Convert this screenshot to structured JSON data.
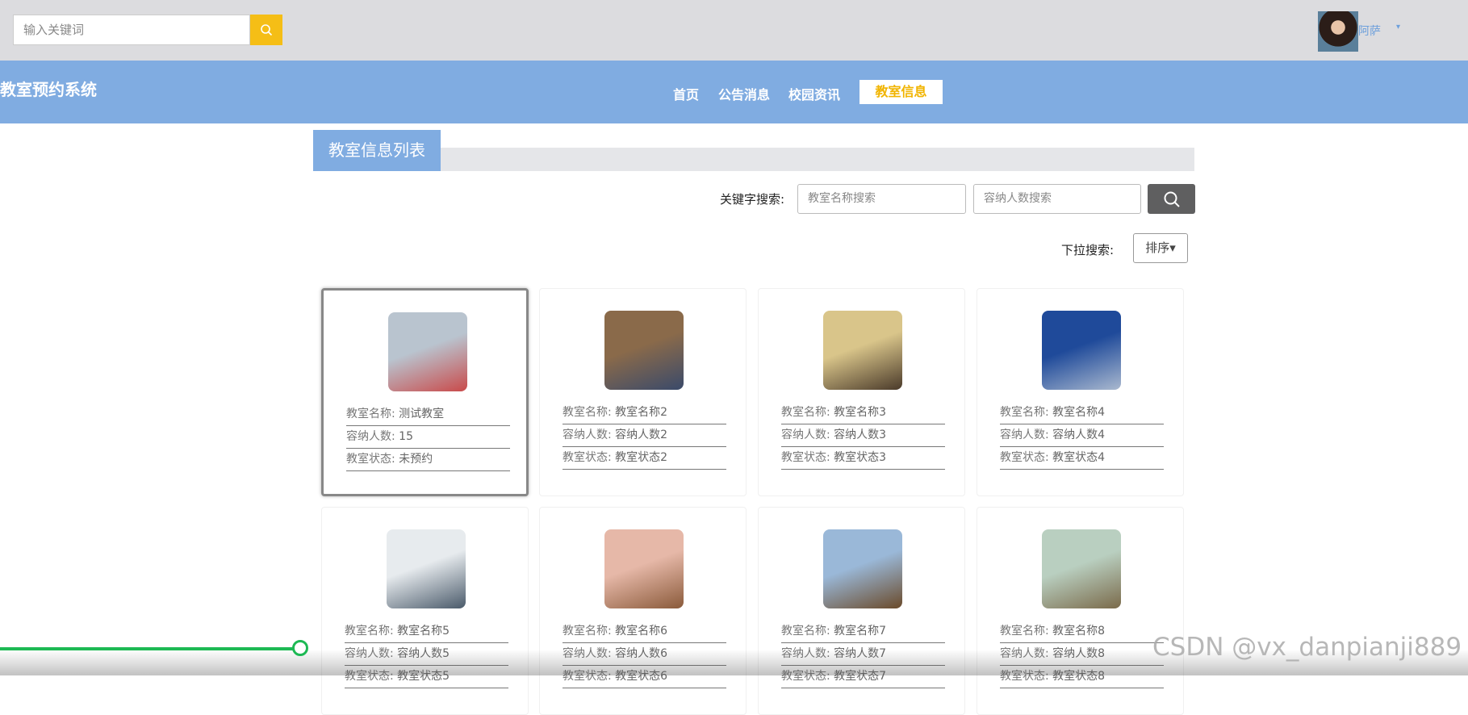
{
  "topbar": {
    "search_placeholder": "输入关键词",
    "username": "阿萨",
    "caret": "▾"
  },
  "nav": {
    "brand": "教室预约系统",
    "items": [
      "首页",
      "公告消息",
      "校园资讯"
    ],
    "active": "教室信息"
  },
  "list": {
    "title": "教室信息列表",
    "keyword_label": "关键字搜索:",
    "name_placeholder": "教室名称搜索",
    "capacity_placeholder": "容纳人数搜索",
    "dropdown_label": "下拉搜索:",
    "sort_label": "排序▾"
  },
  "field_keys": {
    "name": "教室名称:",
    "capacity": "容纳人数:",
    "status": "教室状态:"
  },
  "cards": [
    {
      "name": "测试教室",
      "capacity": "15",
      "status": "未预约",
      "colors": [
        "#b9c4cf",
        "#c94a4a"
      ]
    },
    {
      "name": "教室名称2",
      "capacity": "容纳人数2",
      "status": "教室状态2",
      "colors": [
        "#8a6a4a",
        "#3a4a6a"
      ]
    },
    {
      "name": "教室名称3",
      "capacity": "容纳人数3",
      "status": "教室状态3",
      "colors": [
        "#d9c58a",
        "#4a3a2a"
      ]
    },
    {
      "name": "教室名称4",
      "capacity": "容纳人数4",
      "status": "教室状态4",
      "colors": [
        "#1f4a9a",
        "#aab9cf"
      ]
    },
    {
      "name": "教室名称5",
      "capacity": "容纳人数5",
      "status": "教室状态5",
      "colors": [
        "#e7ebee",
        "#4a5a6a"
      ]
    },
    {
      "name": "教室名称6",
      "capacity": "容纳人数6",
      "status": "教室状态6",
      "colors": [
        "#e6b8a8",
        "#8a5a3a"
      ]
    },
    {
      "name": "教室名称7",
      "capacity": "容纳人数7",
      "status": "教室状态7",
      "colors": [
        "#9ab8d8",
        "#6a4a2a"
      ]
    },
    {
      "name": "教室名称8",
      "capacity": "容纳人数8",
      "status": "教室状态8",
      "colors": [
        "#b9cfc0",
        "#7a6a4a"
      ]
    }
  ],
  "watermark": "CSDN @vx_danpianji889"
}
